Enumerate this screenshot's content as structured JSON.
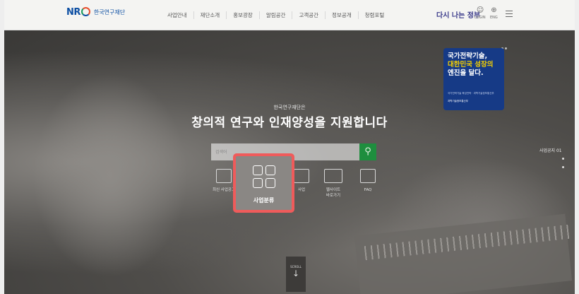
{
  "header": {
    "logo_mark": "NRF",
    "logo_text": "한국연구재단",
    "menu": [
      "사업안내",
      "재단소개",
      "홍보광장",
      "알림공간",
      "고객공간",
      "정보공개",
      "청렴포털"
    ],
    "brand_text": "다시 나는 정부",
    "login_label": "LOGIN",
    "lang_label": "ENG"
  },
  "promo": {
    "title_line1": "국가전략기술,",
    "title_line2": "대한민국 성장의",
    "title_line3": "엔진을 달다.",
    "subtext": "국가전략기술 육성전략 · 과학기술정보통신부",
    "link": "과학기술정보통신부"
  },
  "hero": {
    "small_text": "한국연구재단은",
    "headline": "창의적 연구와 인재양성을 지원합니다",
    "search_placeholder": "검색어",
    "search_icon": "search-icon",
    "accent": "#1e8e3e"
  },
  "quick_links": [
    {
      "label": "최신 사업공고",
      "icon": "document-icon"
    },
    {
      "label": "사업",
      "icon": "monitor-icon"
    },
    {
      "label": "웹사이트\n바로가기",
      "icon": "website-icon"
    },
    {
      "label": "FAQ",
      "icon": "chat-question-icon"
    }
  ],
  "highlight": {
    "label": "사업분류",
    "icon": "grid-icon",
    "color": "#ef5b5b"
  },
  "side": {
    "label": "사업공지 01"
  },
  "scroll": {
    "label": "SCROLL",
    "arrow": "↓"
  }
}
